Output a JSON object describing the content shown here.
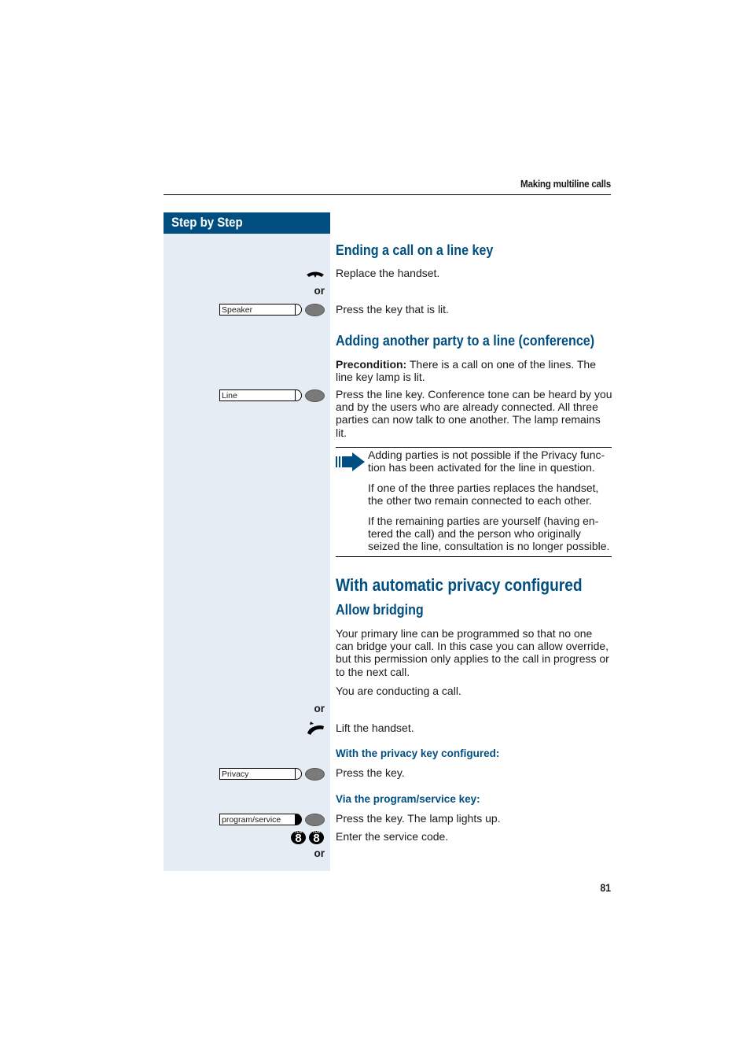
{
  "header": {
    "running_title": "Making multiline calls"
  },
  "sidebar": {
    "title": "Step by Step"
  },
  "sections": {
    "ending": {
      "title": "Ending a call on a line key",
      "step1": "Replace the handset.",
      "or1": "or",
      "speaker_key_label": "Speaker",
      "step2": "Press the key that is lit."
    },
    "conference": {
      "title": "Adding another party to a line (conference)",
      "precondition_label": "Precondition:",
      "precondition_text": " There is a call on one of the lines. The line key lamp is lit.",
      "line_key_label": "Line",
      "step1": "Press the line key. Conference tone can be heard by you and by the users who are already connected. All three parties can now talk to one another. The lamp remains lit.",
      "notes": [
        "Adding parties is not possible if the Privacy func-tion has been activated for the line in question.",
        "If one of the three parties replaces the handset, the other two remain connected to each other.",
        "If the remaining parties are yourself (having en-tered the call) and the person who originally seized the line, consultation is no longer possible."
      ]
    },
    "privacy": {
      "title": "With automatic privacy configured",
      "subtitle": "Allow bridging",
      "intro": "Your primary line can be programmed so that no one can bridge your call. In this case you can allow override, but this permission only applies to the call in progress or to the next call.",
      "conducting": "You are conducting a call.",
      "or1": "or",
      "lift": "Lift the handset.",
      "privacy_key_heading": "With the privacy key configured:",
      "privacy_key_label": "Privacy",
      "privacy_step": "Press the key.",
      "program_heading": "Via the program/service key:",
      "program_key_label": "program/service",
      "program_step": "Press the key. The lamp lights up.",
      "service_code_digits": [
        "8",
        "8"
      ],
      "service_code_sublabels": [
        "TUV",
        "TUV"
      ],
      "service_code_step": "Enter the service code.",
      "or2": "or"
    }
  },
  "footer": {
    "page_number": "81"
  },
  "colors": {
    "accent": "#004f80",
    "sidebar_bg": "#e5ecf3",
    "lamp": "#7a7a7a"
  }
}
